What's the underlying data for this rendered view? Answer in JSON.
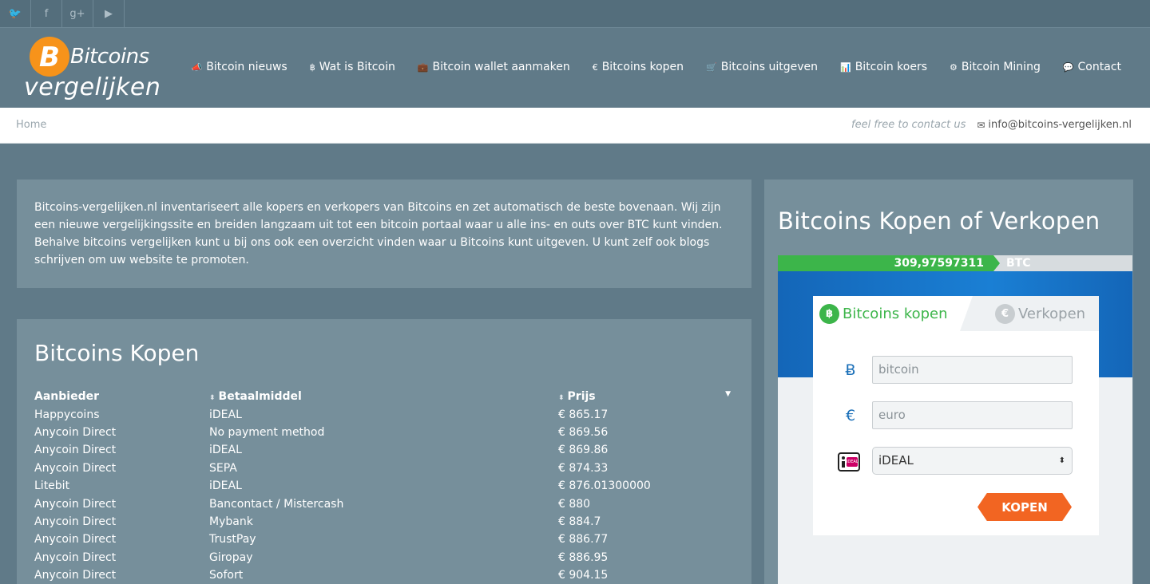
{
  "social": {
    "twitter": "twitter-icon",
    "facebook": "facebook-icon",
    "google": "google-plus-icon",
    "youtube": "youtube-icon"
  },
  "social_glyphs": {
    "twitter": "🐦",
    "facebook": "f",
    "google": "g+",
    "youtube": "▶"
  },
  "logo": {
    "line1": "Bitcoins",
    "line2": "vergelijken",
    "coin_letter": "B"
  },
  "nav": [
    {
      "icon": "📣",
      "label": "Bitcoin nieuws"
    },
    {
      "icon": "฿",
      "label": "Wat is Bitcoin"
    },
    {
      "icon": "💼",
      "label": "Bitcoin wallet aanmaken"
    },
    {
      "icon": "€",
      "label": "Bitcoins kopen"
    },
    {
      "icon": "🛒",
      "label": "Bitcoins uitgeven"
    },
    {
      "icon": "📊",
      "label": "Bitcoin koers"
    },
    {
      "icon": "⚙",
      "label": "Bitcoin Mining"
    },
    {
      "icon": "💬",
      "label": "Contact"
    }
  ],
  "breadcrumb": {
    "home": "Home"
  },
  "contact": {
    "tagline": "feel free to contact us",
    "email": "info@bitcoins-vergelijken.nl"
  },
  "intro": "Bitcoins-vergelijken.nl inventariseert alle kopers en verkopers van Bitcoins en zet automatisch de beste bovenaan. Wij zijn een nieuwe vergelijkingssite en breiden langzaam uit tot een bitcoin portaal waar u alle ins- en outs over BTC kunt vinden. Behalve bitcoins vergelijken kunt u bij ons ook een overzicht vinden waar u Bitcoins kunt uitgeven. U kunt zelf ook blogs schrijven om uw website te promoten.",
  "buy": {
    "title": "Bitcoins Kopen",
    "columns": [
      "Aanbieder",
      "Betaalmiddel",
      "Prijs"
    ],
    "rows": [
      [
        "Happycoins",
        "iDEAL",
        "€ 865.17"
      ],
      [
        "Anycoin Direct",
        "No payment method",
        "€ 869.56"
      ],
      [
        "Anycoin Direct",
        "iDEAL",
        "€ 869.86"
      ],
      [
        "Anycoin Direct",
        "SEPA",
        "€ 874.33"
      ],
      [
        "Litebit",
        "iDEAL",
        "€ 876.01300000"
      ],
      [
        "Anycoin Direct",
        "Bancontact / Mistercash",
        "€ 880"
      ],
      [
        "Anycoin Direct",
        "Mybank",
        "€ 884.7"
      ],
      [
        "Anycoin Direct",
        "TrustPay",
        "€ 886.77"
      ],
      [
        "Anycoin Direct",
        "Giropay",
        "€ 886.95"
      ],
      [
        "Anycoin Direct",
        "Sofort",
        "€ 904.15"
      ]
    ]
  },
  "side": {
    "title": "Bitcoins Kopen of Verkopen",
    "balance": "309,97597311",
    "balance_unit": "BTC",
    "tab_buy": "Bitcoins kopen",
    "tab_sell": "Verkopen",
    "btc_placeholder": "bitcoin",
    "eur_placeholder": "euro",
    "payment_selected": "iDEAL",
    "button": "KOPEN",
    "ideal_badge": "iDEAL"
  }
}
